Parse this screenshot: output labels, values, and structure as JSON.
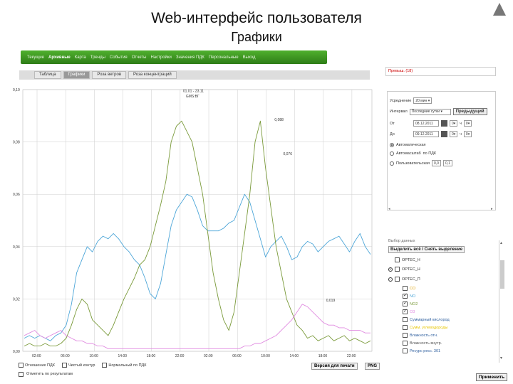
{
  "header": {
    "title": "Web-интерфейс пользователя",
    "subtitle": "Графики"
  },
  "menu": {
    "items": [
      "Текущие",
      "Архивные",
      "Карта",
      "Тренды",
      "События",
      "Отчеты",
      "Настройки",
      "Значения ПДК",
      "Персональные",
      "Выход"
    ],
    "active_index": 1
  },
  "subtabs": {
    "items": [
      "Таблица",
      "Графики",
      "Роза ветров",
      "Роза концентраций"
    ],
    "active_index": 1
  },
  "alerts": {
    "label": "Превыш. (18)"
  },
  "chart_data": {
    "type": "line",
    "ylim": [
      0.0,
      0.1
    ],
    "y_ticks": [
      "0,00",
      "0,02",
      "0,04",
      "0,06",
      "0,08",
      "0,10"
    ],
    "x_ticks": [
      "02:00",
      "06:00",
      "10:00",
      "14:00",
      "18:00",
      "22:00",
      "02:00",
      "06:00",
      "10:00",
      "14:00",
      "18:00",
      "22:00"
    ],
    "annotations": [
      {
        "text": "01.01 - 23.11",
        "x_index": 5.1,
        "y": 0.099
      },
      {
        "text": "GMS:ВГ",
        "x_index": 5.2,
        "y": 0.097
      },
      {
        "text": "0,088",
        "x_index": 8.3,
        "y": 0.088
      },
      {
        "text": "0,076",
        "x_index": 8.6,
        "y": 0.075
      },
      {
        "text": "0,019",
        "x_index": 10.1,
        "y": 0.019
      }
    ],
    "series": [
      {
        "color": "#4da6d8",
        "values": [
          0.005,
          0.006,
          0.005,
          0.006,
          0.005,
          0.004,
          0.006,
          0.007,
          0.01,
          0.018,
          0.03,
          0.035,
          0.04,
          0.038,
          0.042,
          0.044,
          0.043,
          0.045,
          0.043,
          0.04,
          0.038,
          0.035,
          0.033,
          0.028,
          0.022,
          0.02,
          0.026,
          0.037,
          0.048,
          0.054,
          0.057,
          0.06,
          0.059,
          0.054,
          0.048,
          0.046,
          0.046,
          0.046,
          0.047,
          0.049,
          0.05,
          0.055,
          0.06,
          0.057,
          0.05,
          0.043,
          0.036,
          0.04,
          0.042,
          0.044,
          0.04,
          0.035,
          0.036,
          0.04,
          0.042,
          0.041,
          0.038,
          0.04,
          0.042,
          0.043,
          0.044,
          0.041,
          0.038,
          0.042,
          0.045,
          0.04,
          0.037
        ]
      },
      {
        "color": "#7a9a3a",
        "values": [
          0.002,
          0.003,
          0.002,
          0.002,
          0.003,
          0.002,
          0.002,
          0.003,
          0.005,
          0.01,
          0.016,
          0.02,
          0.018,
          0.012,
          0.01,
          0.008,
          0.006,
          0.01,
          0.015,
          0.02,
          0.024,
          0.028,
          0.033,
          0.035,
          0.04,
          0.048,
          0.056,
          0.065,
          0.08,
          0.086,
          0.088,
          0.084,
          0.08,
          0.07,
          0.06,
          0.045,
          0.03,
          0.02,
          0.012,
          0.008,
          0.015,
          0.03,
          0.045,
          0.06,
          0.08,
          0.088,
          0.07,
          0.055,
          0.04,
          0.03,
          0.02,
          0.015,
          0.01,
          0.008,
          0.005,
          0.006,
          0.004,
          0.005,
          0.006,
          0.004,
          0.005,
          0.006,
          0.004,
          0.005,
          0.004,
          0.003,
          0.004
        ]
      },
      {
        "color": "#e08ae0",
        "values": [
          0.006,
          0.007,
          0.008,
          0.006,
          0.005,
          0.006,
          0.007,
          0.008,
          0.006,
          0.005,
          0.004,
          0.004,
          0.003,
          0.003,
          0.002,
          0.002,
          0.001,
          0.001,
          0.001,
          0.001,
          0.001,
          0.001,
          0.001,
          0.001,
          0.001,
          0.001,
          0.001,
          0.001,
          0.001,
          0.001,
          0.001,
          0.001,
          0.001,
          0.001,
          0.001,
          0.001,
          0.001,
          0.001,
          0.001,
          0.001,
          0.001,
          0.001,
          0.002,
          0.002,
          0.003,
          0.003,
          0.004,
          0.005,
          0.006,
          0.008,
          0.01,
          0.012,
          0.015,
          0.018,
          0.017,
          0.015,
          0.013,
          0.011,
          0.01,
          0.01,
          0.009,
          0.009,
          0.008,
          0.008,
          0.008,
          0.007,
          0.007
        ]
      }
    ]
  },
  "controls": {
    "period_label": "Усреднение",
    "period_value": "20 мин",
    "interval_label": "Интервал",
    "interval_value": "Последние сутки",
    "prev_button": "Предыдущий",
    "from_label": "От",
    "from_date": "08.12.2011",
    "from_h": "0",
    "from_m": "0",
    "from_unit": "ч",
    "to_label": "До",
    "to_date": "09.12.2011",
    "to_h": "0",
    "to_m": "0",
    "to_unit": "ч",
    "radio1": "Автоматическая",
    "radio2": "Автомасштаб",
    "radio2_suffix": "по ПДК",
    "radio3": "Пользовательская",
    "radio3_from": "0,0",
    "radio3_to": "0,1"
  },
  "params": {
    "title": "Выбор данных",
    "select_all": "Выделить всё / Снять выделение",
    "nodes": [
      {
        "label": "ОРТЕС_Н",
        "checked": false
      },
      {
        "label": "ОРТЕС_Н",
        "checked": false
      },
      {
        "label": "ОРТЕС_П",
        "checked": false
      }
    ],
    "leaves": [
      {
        "label": "CO",
        "checked": false,
        "color": "#e0a000"
      },
      {
        "label": "NO",
        "checked": true,
        "color": "#4da6d8"
      },
      {
        "label": "NO2",
        "checked": true,
        "color": "#7a9a3a"
      },
      {
        "label": "O3",
        "checked": true,
        "color": "#e08ae0"
      },
      {
        "label": "Суммарный кислород",
        "checked": false,
        "color": "#2d5e9e"
      },
      {
        "label": "Сумм. углеводороды",
        "checked": false,
        "color": "#e8c600"
      },
      {
        "label": "Влажность отн.",
        "checked": false,
        "color": "#2d5e9e"
      },
      {
        "label": "Влажность внутр.",
        "checked": false,
        "color": "#555555"
      },
      {
        "label": "Ресурс ресс. 301",
        "checked": false,
        "color": "#2d5e9e"
      }
    ],
    "apply": "Применить"
  },
  "legend": {
    "items": [
      "Отношение ПДК",
      "Чистый контур",
      "Нормальный по ПДК"
    ],
    "row2": "Отметить по результатам"
  },
  "buttons": {
    "print": "Версия для печати",
    "png": "PNG"
  }
}
